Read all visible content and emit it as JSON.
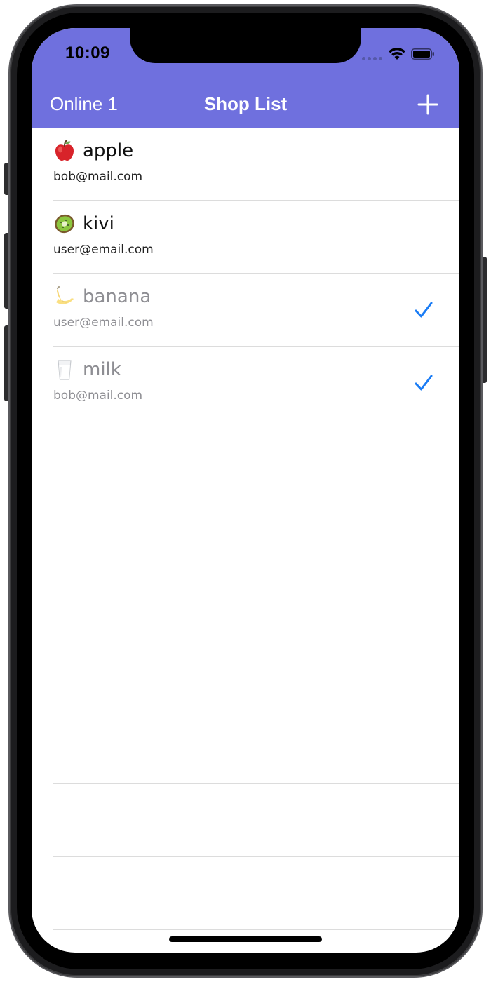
{
  "status": {
    "time": "10:09"
  },
  "nav": {
    "left_label": "Online 1",
    "title": "Shop List",
    "add_icon": "plus-icon"
  },
  "colors": {
    "nav_bar": "#6f70de",
    "check": "#1a7cf5",
    "done_text": "#8e8e93"
  },
  "items": [
    {
      "icon": "apple-icon",
      "name": "apple",
      "email": "bob@mail.com",
      "done": false
    },
    {
      "icon": "kiwi-icon",
      "name": "kivi",
      "email": "user@email.com",
      "done": false
    },
    {
      "icon": "banana-icon",
      "name": "banana",
      "email": "user@email.com",
      "done": true
    },
    {
      "icon": "milk-icon",
      "name": "milk",
      "email": "bob@mail.com",
      "done": true
    }
  ]
}
